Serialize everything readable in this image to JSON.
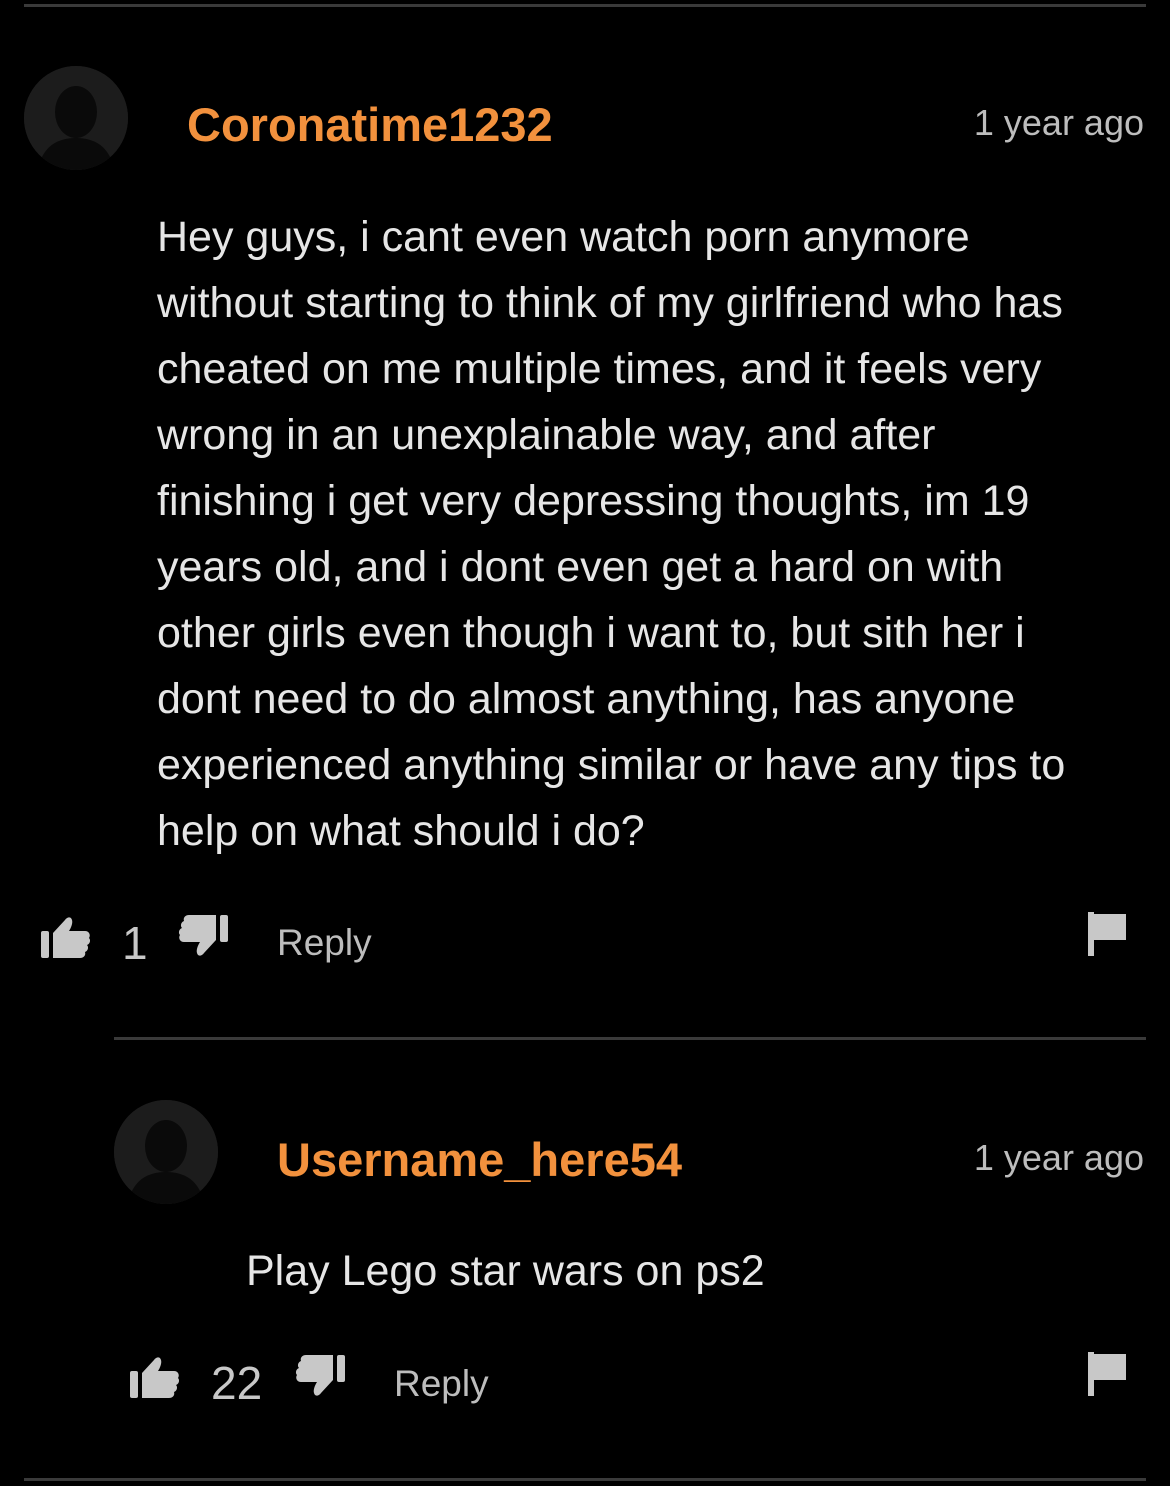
{
  "comments": [
    {
      "username": "Coronatime1232",
      "timestamp": "1 year ago",
      "body_lines": [
        "Hey guys, i cant even watch porn anymore",
        "without starting to think of my girlfriend who has",
        "cheated on me multiple times, and it feels very",
        "wrong in an unexplainable way, and after",
        "finishing i get very depressing thoughts, im 19",
        "years old, and i dont even get a hard on with",
        "other girls even though i want to, but sith her i",
        "dont need to do almost anything, has anyone",
        "experienced anything similar or have any tips to",
        "help on what should i do?"
      ],
      "likes": "1",
      "reply_label": "Reply",
      "icons": [
        "user-avatar-icon",
        "thumbs-up-icon",
        "thumbs-down-icon",
        "flag-icon"
      ]
    },
    {
      "username": "Username_here54",
      "timestamp": "1 year ago",
      "body_lines": [
        "Play Lego star wars on ps2"
      ],
      "likes": "22",
      "reply_label": "Reply",
      "icons": [
        "user-avatar-icon",
        "thumbs-up-icon",
        "thumbs-down-icon",
        "flag-icon"
      ]
    }
  ],
  "colors": {
    "background": "#000000",
    "username": "#f2913d",
    "text": "#e6e6e6",
    "muted": "#bdbdbd",
    "divider": "#3a3a3a",
    "avatar": "#1c1c1c",
    "icon": "#c8c8c8"
  }
}
